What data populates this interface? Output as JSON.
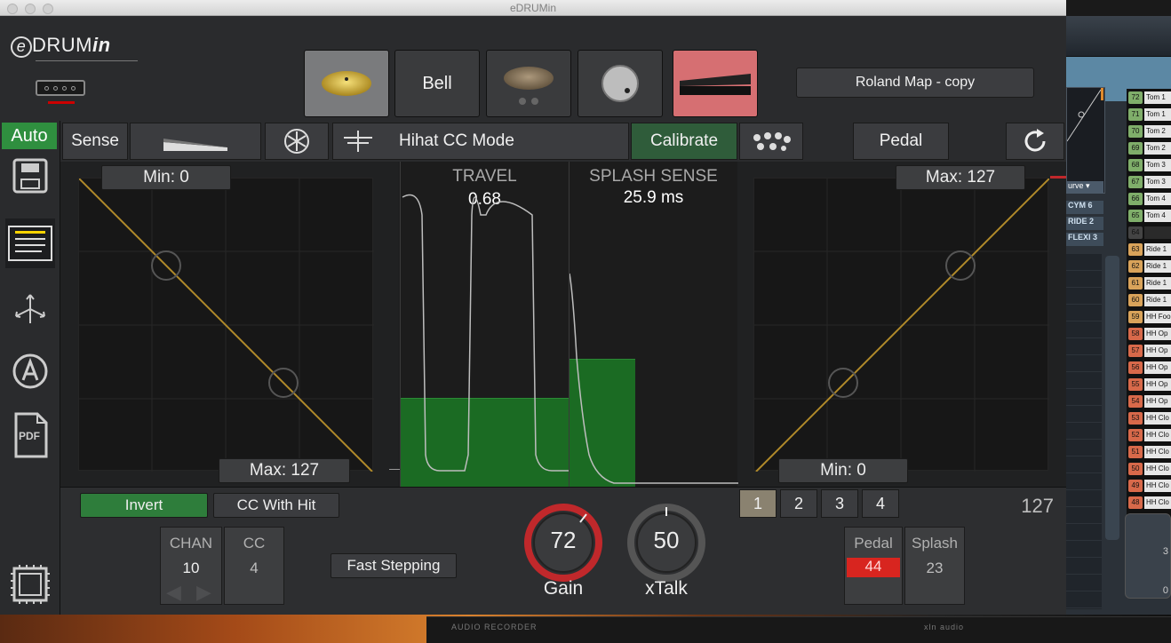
{
  "window": {
    "title": "eDRUMin"
  },
  "logo": {
    "e": "e",
    "drum": "DRUM",
    "in": "in"
  },
  "zones": {
    "items": [
      {
        "name": "cymbal-bow-zone-button",
        "icon": "cymbal-icon",
        "label": "",
        "state": "selected"
      },
      {
        "name": "bell-zone-button",
        "icon": "",
        "label": "Bell",
        "state": "normal"
      },
      {
        "name": "cymbal-edge-zone-button",
        "icon": "cymbal-edge-icon",
        "label": "",
        "state": "normal"
      },
      {
        "name": "knob-zone-button",
        "icon": "knob-icon",
        "label": "",
        "state": "normal"
      },
      {
        "name": "pedal-zone-button",
        "icon": "pedal-icon",
        "label": "",
        "state": "active"
      }
    ]
  },
  "map": {
    "name": "Roland Map - copy"
  },
  "sidebar": {
    "auto": "Auto",
    "icons": [
      "save-icon",
      "list-icon",
      "routing-icon",
      "auto-icon",
      "pdf-icon",
      "chip-icon"
    ],
    "pdf": "PDF"
  },
  "toolbar": {
    "sense": "Sense",
    "mode": "Hihat CC Mode",
    "calibrate": "Calibrate",
    "pedal": "Pedal"
  },
  "left_plot": {
    "min_label": "Min: 0",
    "max_label": "Max: 127"
  },
  "right_plot": {
    "max_label": "Max: 127",
    "min_label": "Min: 0"
  },
  "travel": {
    "caption": "TRAVEL",
    "value": "0.68"
  },
  "splash": {
    "caption": "SPLASH SENSE",
    "value": "25.9 ms"
  },
  "bottom": {
    "invert": "Invert",
    "cc_with_hit": "CC With Hit",
    "chan_label": "CHAN",
    "chan_value": "10",
    "cc_label": "CC",
    "cc_value": "4",
    "fast_stepping": "Fast Stepping",
    "gain_value": "72",
    "gain_label": "Gain",
    "xtalk_value": "50",
    "xtalk_label": "xTalk",
    "tabs": [
      "1",
      "2",
      "3",
      "4"
    ],
    "selected_tab": "1",
    "level": "127",
    "pedal_label": "Pedal",
    "pedal_value": "44",
    "splash_label": "Splash",
    "splash_value": "23"
  },
  "background_app": {
    "curve": "urve",
    "maps": [
      "CYM 6",
      "RIDE 2",
      "FLEXI 3"
    ],
    "notes": [
      {
        "num": "72",
        "name": "Tom 1"
      },
      {
        "num": "71",
        "name": "Tom 1"
      },
      {
        "num": "70",
        "name": "Tom 2"
      },
      {
        "num": "69",
        "name": "Tom 2"
      },
      {
        "num": "68",
        "name": "Tom 3"
      },
      {
        "num": "67",
        "name": "Tom 3"
      },
      {
        "num": "66",
        "name": "Tom 4"
      },
      {
        "num": "65",
        "name": "Tom 4"
      },
      {
        "num": "64",
        "name": ""
      },
      {
        "num": "63",
        "name": "Ride 1"
      },
      {
        "num": "62",
        "name": "Ride 1"
      },
      {
        "num": "61",
        "name": "Ride 1"
      },
      {
        "num": "60",
        "name": "Ride 1"
      },
      {
        "num": "59",
        "name": "HH Foo"
      },
      {
        "num": "58",
        "name": "HH Op"
      },
      {
        "num": "57",
        "name": "HH Op"
      },
      {
        "num": "56",
        "name": "HH Op"
      },
      {
        "num": "55",
        "name": "HH Op"
      },
      {
        "num": "54",
        "name": "HH Op"
      },
      {
        "num": "53",
        "name": "HH Clo"
      },
      {
        "num": "52",
        "name": "HH Clo"
      },
      {
        "num": "51",
        "name": "HH Clo"
      },
      {
        "num": "50",
        "name": "HH Clo"
      },
      {
        "num": "49",
        "name": "HH Clo"
      },
      {
        "num": "48",
        "name": "HH Clo"
      }
    ],
    "box_values": [
      "3",
      "0"
    ]
  },
  "taskbar": {
    "recorder": "AUDIO RECORDER",
    "brand": "xln audio"
  },
  "colors": {
    "accent_green": "#2e7d3b",
    "pedal_red": "#d66f72",
    "curve": "#b08a2a",
    "knob_red": "#c0282b"
  }
}
